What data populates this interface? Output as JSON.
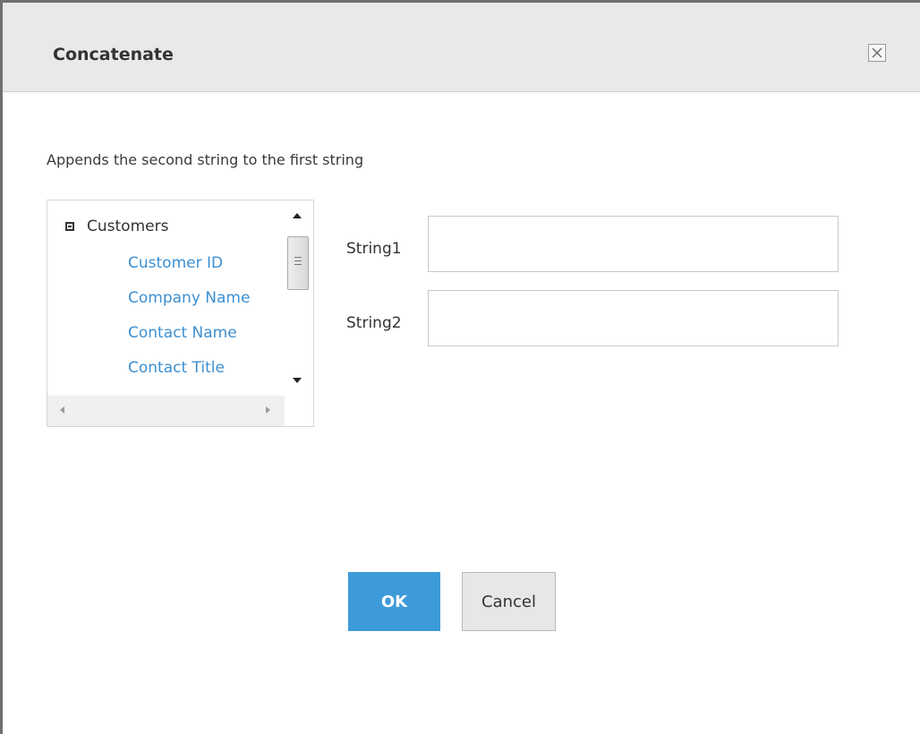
{
  "dialog": {
    "title": "Concatenate",
    "description": "Appends the second string to the first string"
  },
  "tree": {
    "root_label": "Customers",
    "expanded": true,
    "items": [
      {
        "label": "Customer ID"
      },
      {
        "label": "Company Name"
      },
      {
        "label": "Contact Name"
      },
      {
        "label": "Contact Title"
      }
    ]
  },
  "fields": [
    {
      "label": "String1",
      "value": ""
    },
    {
      "label": "String2",
      "value": ""
    }
  ],
  "buttons": {
    "ok_label": "OK",
    "cancel_label": "Cancel"
  },
  "colors": {
    "accent": "#3d9bd9",
    "link": "#3d8fd0",
    "titlebar": "#e9e9e9"
  },
  "icons": {
    "close": "close-icon",
    "collapse": "minus-box-icon"
  }
}
